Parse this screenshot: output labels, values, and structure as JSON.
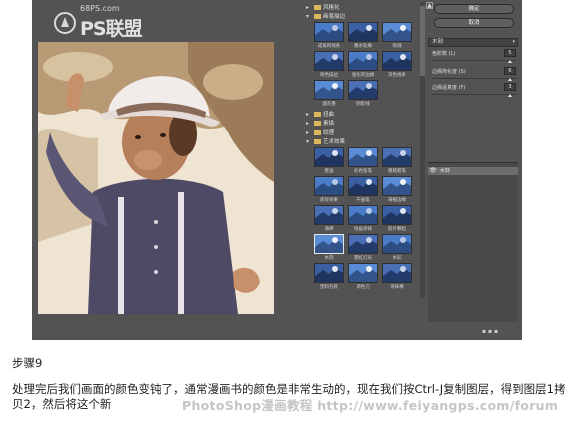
{
  "logo": {
    "site": "68PS.com",
    "mark": "PS联盟"
  },
  "gallery": {
    "categories": [
      {
        "label": "风格化",
        "expanded": false
      },
      {
        "label": "画笔描边",
        "expanded": true
      },
      {
        "label": "扭曲",
        "expanded": false
      },
      {
        "label": "素描",
        "expanded": false
      },
      {
        "label": "纹理",
        "expanded": false
      },
      {
        "label": "艺术效果",
        "expanded": true
      }
    ],
    "brush_thumbs": [
      "成角的线条",
      "墨水轮廓",
      "喷溅",
      "喷色描边",
      "强化的边缘",
      "深色线条",
      "烟灰墨",
      "阴影线"
    ],
    "art_thumbs": [
      "壁画",
      "彩色铅笔",
      "粗糙蜡笔",
      "底纹效果",
      "干画笔",
      "海报边缘",
      "海绵",
      "绘画涂抹",
      "胶片颗粒",
      "木刻",
      "霓虹灯光",
      "水彩",
      "塑料包装",
      "调色刀",
      "涂抹棒"
    ],
    "selected": "木刻"
  },
  "scroll_up": "▲",
  "buttons": {
    "ok": "确定",
    "cancel": "取消"
  },
  "filter_select": {
    "value": "木刻",
    "chev": "▾"
  },
  "params": [
    {
      "label": "色阶数 (L)",
      "value": "5",
      "level": 0.93
    },
    {
      "label": "边缘简化度 (S)",
      "value": "6",
      "level": 0.93
    },
    {
      "label": "边缘逼真度 (F)",
      "value": "3",
      "level": 0.93
    }
  ],
  "layer": {
    "label": "木刻",
    "eye": "👁"
  },
  "layer_foot": "▪ ▪ ▪",
  "article": {
    "step": "步骤9",
    "paragraph": "处理完后我们画面的颜色变钝了，通常漫画书的颜色是非常生动的，现在我们按Ctrl-J复制图层，得到图层1拷贝2，然后将这个新",
    "watermark": "PhotoShop漫画教程  http://www.feiyangps.com/forum"
  }
}
